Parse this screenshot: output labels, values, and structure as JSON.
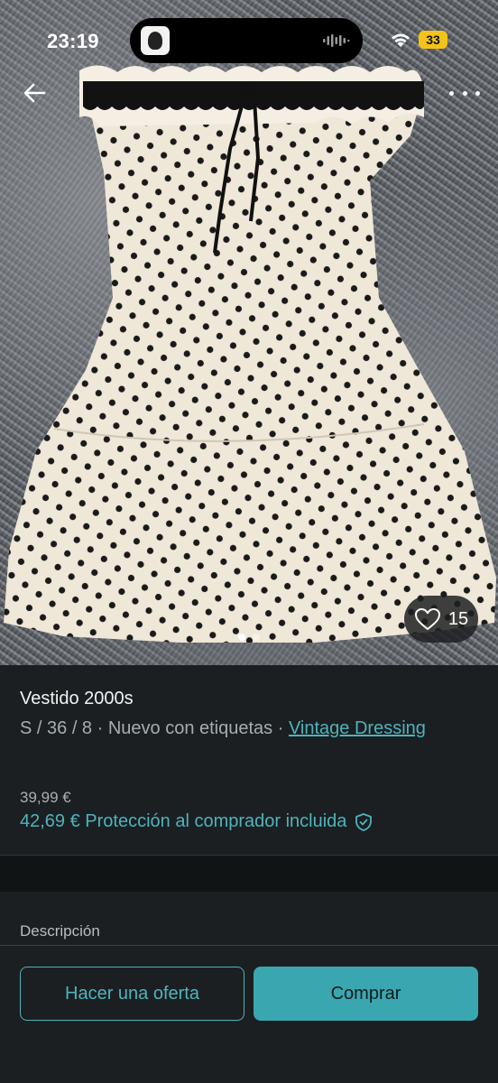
{
  "status_bar": {
    "time": "23:19",
    "battery": "33",
    "icons": [
      "wifi-icon",
      "battery-icon"
    ]
  },
  "nav": {
    "back_icon": "arrow-left-icon",
    "more_icon": "more-horizontal-icon"
  },
  "photo": {
    "favorites_count": "15",
    "favorite_icon": "heart-icon",
    "image_count": 2,
    "active_image_index": 1
  },
  "product": {
    "title": "Vestido 2000s",
    "meta_prefix": "S / 36 / 8 · Nuevo con etiquetas · ",
    "brand_link": "Vintage Dressing",
    "price_base": "39,99 €",
    "price_total": "42,69 € Protección al comprador incluida",
    "protection_icon": "shield-check-icon"
  },
  "description": {
    "label": "Descripción"
  },
  "actions": {
    "offer_label": "Hacer una oferta",
    "buy_label": "Comprar"
  },
  "colors": {
    "accent": "#4fb3bd",
    "buy_button": "#3aa7b0",
    "background": "#1b1f21"
  }
}
